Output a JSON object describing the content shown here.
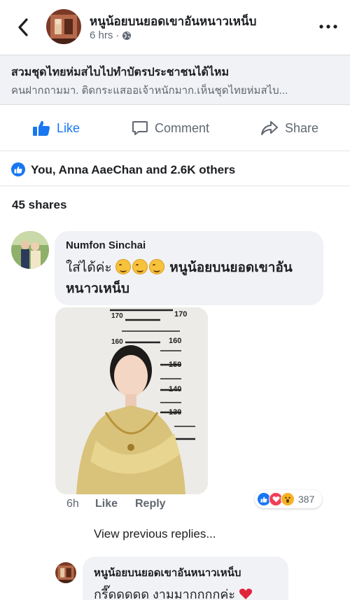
{
  "header": {
    "page_name": "หนูน้อยบนยอดเขาอันหนาวเหน็บ",
    "time": "6 hrs",
    "visibility_sep": "·"
  },
  "link_preview": {
    "title": "สวมชุดไทยห่มสไบไปทำบัตรประชาชนได้ไหม",
    "description": "คนฝากถามมา. ติดกระแสออเจ้าหนักมาก.เห็นชุดไทยห่มสไบ..."
  },
  "actions": {
    "like": "Like",
    "comment": "Comment",
    "share": "Share"
  },
  "reactions": {
    "summary": "You, Anna AaeChan and 2.6K others"
  },
  "shares": "45 shares",
  "comment": {
    "author": "Numfon Sinchai",
    "text_before": "ใส่ได้ค่ะ",
    "tagged": "หนูน้อยบนยอดเขาอันหนาวเหน็บ",
    "height_chart_labels": [
      "170",
      "170",
      "160",
      "160",
      "150",
      "140",
      "130"
    ],
    "time": "6h",
    "like": "Like",
    "reply": "Reply",
    "reaction_count": "387"
  },
  "view_previous": "View previous replies...",
  "reply": {
    "author": "หนูน้อยบนยอดเขาอันหนาวเหน็บ",
    "text": "กรี๊ดดดดด งามมากกกกค่ะ"
  },
  "colors": {
    "brand_blue": "#1877f2",
    "bubble_bg": "#f0f2f5",
    "muted": "#606770",
    "love_red": "#f33e58",
    "wow_yellow": "#f7b125"
  }
}
